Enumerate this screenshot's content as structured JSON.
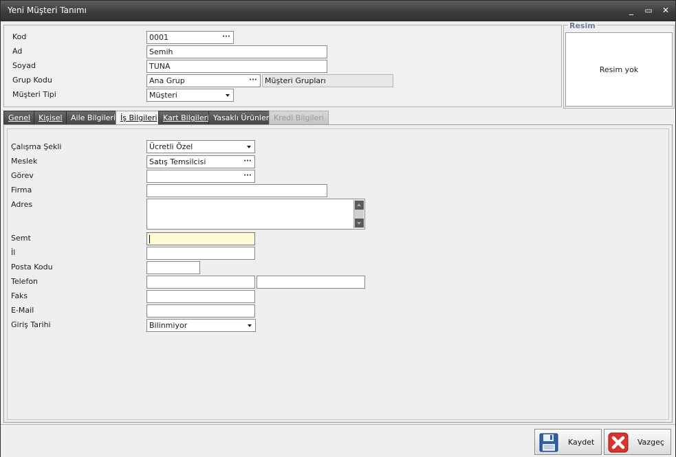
{
  "window": {
    "title": "Yeni Müşteri Tanımı",
    "minimize": "_",
    "maximize": "▭",
    "close": "✕"
  },
  "header": {
    "kod_label": "Kod",
    "kod_value": "0001",
    "ad_label": "Ad",
    "ad_value": "Semih",
    "soyad_label": "Soyad",
    "soyad_value": "TUNA",
    "grup_kodu_label": "Grup Kodu",
    "grup_kodu_value": "Ana Grup",
    "grup_kodu_desc": "Müşteri Grupları",
    "musteri_tipi_label": "Müşteri Tipi",
    "musteri_tipi_value": "Müşteri",
    "ellipsis": "···"
  },
  "resim": {
    "legend": "Resim",
    "placeholder": "Resim yok"
  },
  "tabs": [
    {
      "label": "Genel",
      "state": "normal"
    },
    {
      "label": "Kişisel",
      "state": "normal"
    },
    {
      "label": "Aile Bilgileri",
      "state": "normal"
    },
    {
      "label": "İş Bilgileri",
      "state": "active"
    },
    {
      "label": "Kart Bilgileri",
      "state": "normal"
    },
    {
      "label": "Yasaklı Ürünler",
      "state": "normal"
    },
    {
      "label": "Kredi Bilgileri",
      "state": "disabled"
    }
  ],
  "is_bilgileri": {
    "calisma_sekli_label": "Çalışma Şekli",
    "calisma_sekli_value": "Ücretli Özel",
    "meslek_label": "Meslek",
    "meslek_value": "Satış Temsilcisi",
    "gorev_label": "Görev",
    "gorev_value": "",
    "firma_label": "Firma",
    "firma_value": "",
    "adres_label": "Adres",
    "adres_value": "",
    "semt_label": "Semt",
    "semt_value": "",
    "il_label": "İl",
    "il_value": "",
    "posta_kodu_label": "Posta Kodu",
    "posta_kodu_value": "",
    "telefon_label": "Telefon",
    "telefon1_value": "",
    "telefon2_value": "",
    "faks_label": "Faks",
    "faks_value": "",
    "email_label": "E-Mail",
    "email_value": "",
    "giris_tarihi_label": "Giriş Tarihi",
    "giris_tarihi_value": "Bilinmiyor"
  },
  "footer": {
    "save_label": "Kaydet",
    "cancel_label": "Vazgeç"
  },
  "colors": {
    "titlebar": "#3b3b3b",
    "active_field": "#fffbd6",
    "resim_legend": "#6a7c9a",
    "cancel_icon": "#d9342b",
    "save_icon": "#2f5fa8"
  }
}
